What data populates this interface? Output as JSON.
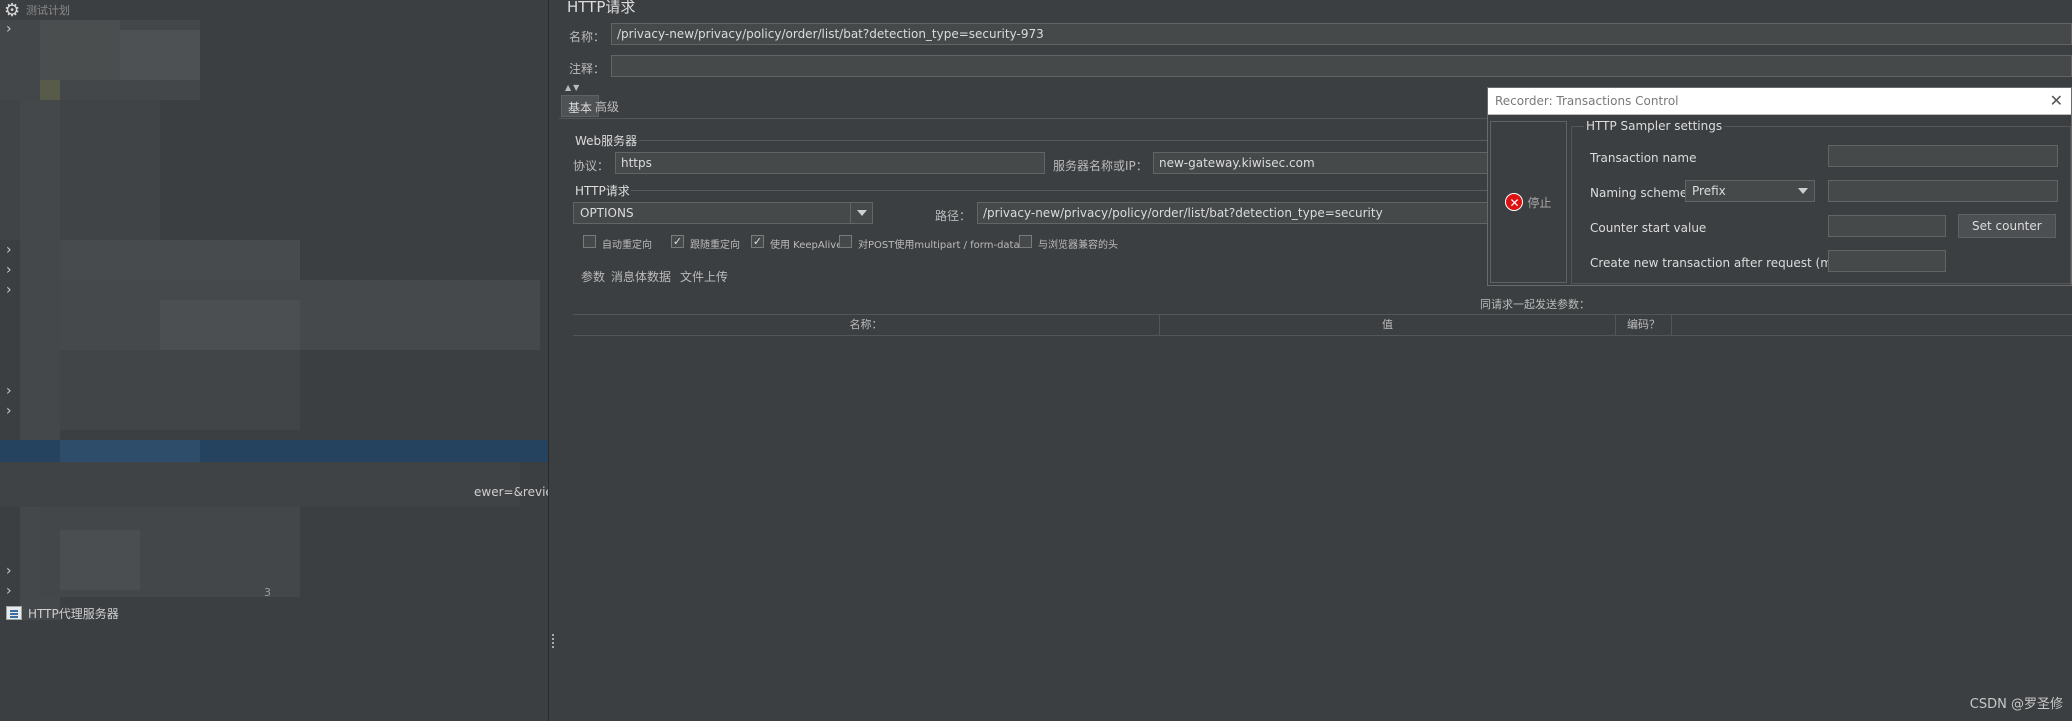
{
  "tree": {
    "root_label": "测试计划",
    "proxy_node_label": "HTTP代理服务器",
    "partial_text": "ewer=&revie",
    "partial_text2": "3"
  },
  "sampler": {
    "title": "HTTP请求",
    "name_label": "名称：",
    "name_value": "/privacy-new/privacy/policy/order/list/bat?detection_type=security-973",
    "comment_label": "注释：",
    "comment_value": "",
    "tabs": [
      "基本",
      "高级"
    ],
    "web_server": {
      "group_title": "Web服务器",
      "protocol_label": "协议：",
      "protocol_value": "https",
      "server_label": "服务器名称或IP：",
      "server_value": "new-gateway.kiwisec.com"
    },
    "http_request": {
      "group_title": "HTTP请求",
      "method": "OPTIONS",
      "path_label": "路径：",
      "path_value": "/privacy-new/privacy/policy/order/list/bat?detection_type=security"
    },
    "options": [
      {
        "label": "自动重定向",
        "checked": false
      },
      {
        "label": "跟随重定向",
        "checked": true
      },
      {
        "label": "使用 KeepAlive",
        "checked": true
      },
      {
        "label": "对POST使用multipart / form-data",
        "checked": false
      },
      {
        "label": "与浏览器兼容的头",
        "checked": false
      }
    ],
    "subtabs": [
      "参数",
      "消息体数据",
      "文件上传"
    ],
    "params_caption": "同请求一起发送参数：",
    "params_columns": [
      "名称：",
      "值",
      "编码？",
      ""
    ]
  },
  "recorder": {
    "title": "Recorder: Transactions Control",
    "stop_label": "停止",
    "settings_legend": "HTTP Sampler settings",
    "transaction_name_label": "Transaction name",
    "transaction_name_value": "",
    "naming_scheme_label": "Naming scheme",
    "naming_scheme_value": "Prefix",
    "naming_scheme_extra": "",
    "counter_start_label": "Counter start value",
    "counter_start_value": "",
    "set_counter_label": "Set counter",
    "create_after_label": "Create new transaction after request (ms):",
    "create_after_value": ""
  },
  "watermark": "CSDN @罗圣修"
}
